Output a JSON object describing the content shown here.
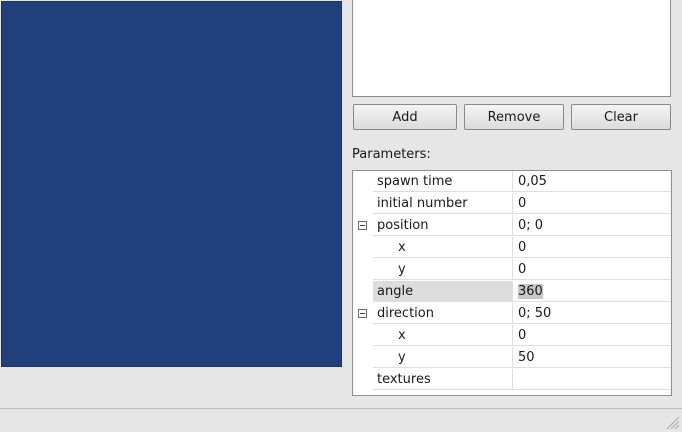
{
  "buttons": {
    "add": "Add",
    "remove": "Remove",
    "clear": "Clear"
  },
  "parameters_label": "Parameters:",
  "properties": {
    "spawn_time": {
      "name": "spawn time",
      "value": "0,05"
    },
    "initial_number": {
      "name": "initial number",
      "value": "0"
    },
    "position": {
      "name": "position",
      "value": "0; 0",
      "x": {
        "name": "x",
        "value": "0"
      },
      "y": {
        "name": "y",
        "value": "0"
      }
    },
    "angle": {
      "name": "angle",
      "value": "360"
    },
    "direction": {
      "name": "direction",
      "value": "0; 50",
      "x": {
        "name": "x",
        "value": "0"
      },
      "y": {
        "name": "y",
        "value": "50"
      }
    },
    "textures": {
      "name": "textures",
      "value": ""
    }
  },
  "colors": {
    "canvas": "#213f7b",
    "window": "#e6e6e6"
  },
  "icons": {
    "expander": "collapse-icon",
    "grip": "size-grip-icon"
  }
}
